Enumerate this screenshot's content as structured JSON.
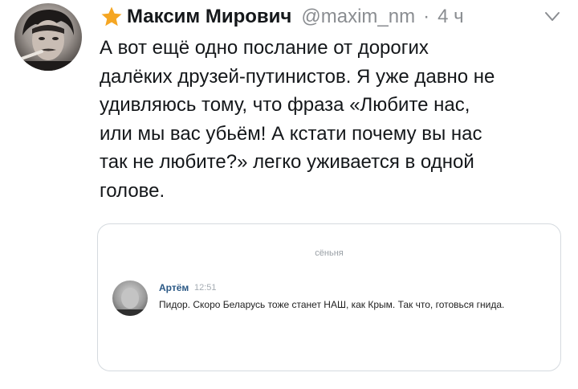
{
  "tweet": {
    "author_name": "Максим Мирович",
    "handle": "@maxim_nm",
    "separator": "·",
    "time": "4 ч",
    "text": "А вот ещё одно послание от дорогих\nдалёких друзей-путинистов. Я уже давно не\nудивляюсь тому, что фраза «Любите нас,\nили мы вас убьём! А кстати почему вы нас\nтак не любите?» легко уживается в одной\nголове."
  },
  "embedded_message": {
    "date_separator": "сёньня",
    "author": "Артём",
    "time": "12:51",
    "text": "Пидор. Скоро Беларусь тоже станет НАШ, как Крым. Так что, готовься гнида."
  },
  "colors": {
    "star": "#f5a623",
    "link_name": "#2a5885",
    "muted": "#8a8d91"
  }
}
